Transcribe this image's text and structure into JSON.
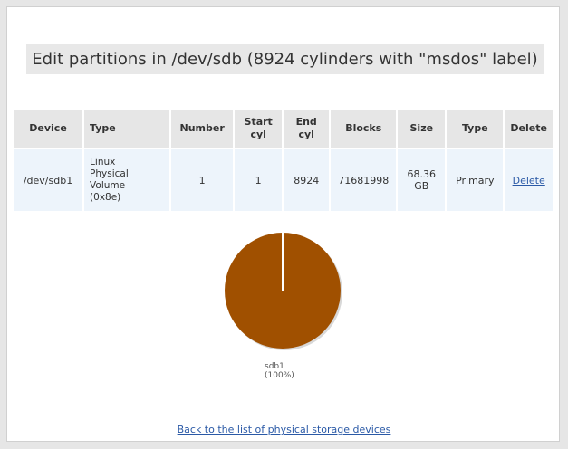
{
  "title": "Edit partitions in /dev/sdb (8924 cylinders with \"msdos\" label)",
  "table": {
    "headers": {
      "device": "Device",
      "type": "Type",
      "number": "Number",
      "start_cyl_1": "Start",
      "start_cyl_2": "cyl",
      "end_cyl_1": "End",
      "end_cyl_2": "cyl",
      "blocks": "Blocks",
      "size": "Size",
      "ptype": "Type",
      "delete": "Delete"
    },
    "rows": [
      {
        "device": "/dev/sdb1",
        "type_line1": "Linux",
        "type_line2": "Physical",
        "type_line3": "Volume",
        "type_line4": "(0x8e)",
        "number": "1",
        "start_cyl": "1",
        "end_cyl": "8924",
        "blocks": "71681998",
        "size_line1": "68.36",
        "size_line2": "GB",
        "ptype": "Primary",
        "delete_link": "Delete"
      }
    ]
  },
  "chart_data": {
    "type": "pie",
    "slices": [
      {
        "name": "sdb1",
        "value": 100,
        "color": "#a05000"
      }
    ],
    "labels": [
      {
        "line1": "sdb1",
        "line2": "(100%)"
      }
    ]
  },
  "back_link": "Back to the list of physical storage devices"
}
